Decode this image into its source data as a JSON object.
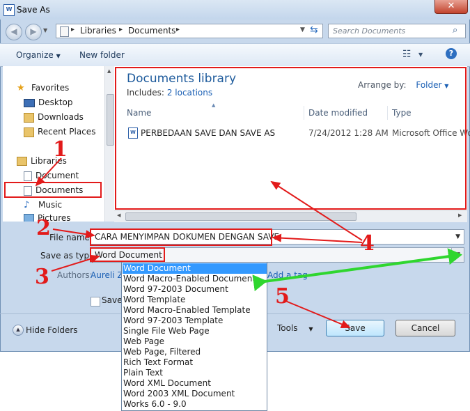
{
  "window": {
    "title": "Save As",
    "app_icon": "W"
  },
  "address": {
    "crumbs": [
      "Libraries",
      "Documents"
    ],
    "search_placeholder": "Search Documents"
  },
  "toolbar": {
    "organize": "Organize",
    "new_folder": "New folder"
  },
  "nav": {
    "favorites": "Favorites",
    "favorites_items": [
      "Desktop",
      "Downloads",
      "Recent Places"
    ],
    "libraries": "Libraries",
    "libraries_items": [
      "Document",
      "Documents",
      "Music",
      "Pictures"
    ]
  },
  "library": {
    "title": "Documents library",
    "includes_label": "Includes:",
    "includes_link": "2 locations",
    "arrange_label": "Arrange by:",
    "arrange_value": "Folder"
  },
  "columns": {
    "name": "Name",
    "date": "Date modified",
    "type": "Type"
  },
  "file_row": {
    "name": "PERBEDAAN SAVE DAN SAVE AS",
    "date": "7/24/2012 1:28 AM",
    "type": "Microsoft Office Wo"
  },
  "form": {
    "file_name_label": "File name:",
    "file_name_value": "CARA MENYIMPAN DOKUMEN DENGAN SAVE",
    "save_type_label": "Save as type:",
    "save_type_value": "Word Document",
    "authors_label": "Authors:",
    "authors_value": "Aureli Za",
    "add_tag": "Add a tag",
    "save_thumb": "Save T"
  },
  "save_types": [
    "Word Document",
    "Word Macro-Enabled Document",
    "Word 97-2003 Document",
    "Word Template",
    "Word Macro-Enabled Template",
    "Word 97-2003 Template",
    "Single File Web Page",
    "Web Page",
    "Web Page, Filtered",
    "Rich Text Format",
    "Plain Text",
    "Word XML Document",
    "Word 2003 XML Document",
    "Works 6.0 - 9.0"
  ],
  "footer": {
    "hide_folders": "Hide Folders",
    "tools": "Tools",
    "save": "Save",
    "cancel": "Cancel"
  },
  "annotations": {
    "n1": "1",
    "n2": "2",
    "n3": "3",
    "n4": "4",
    "n5": "5"
  },
  "colors": {
    "annotation_red": "#e21a1a",
    "annotation_green": "#2fd62f",
    "selection_blue": "#3399ff",
    "library_title": "#1e5b9c"
  }
}
